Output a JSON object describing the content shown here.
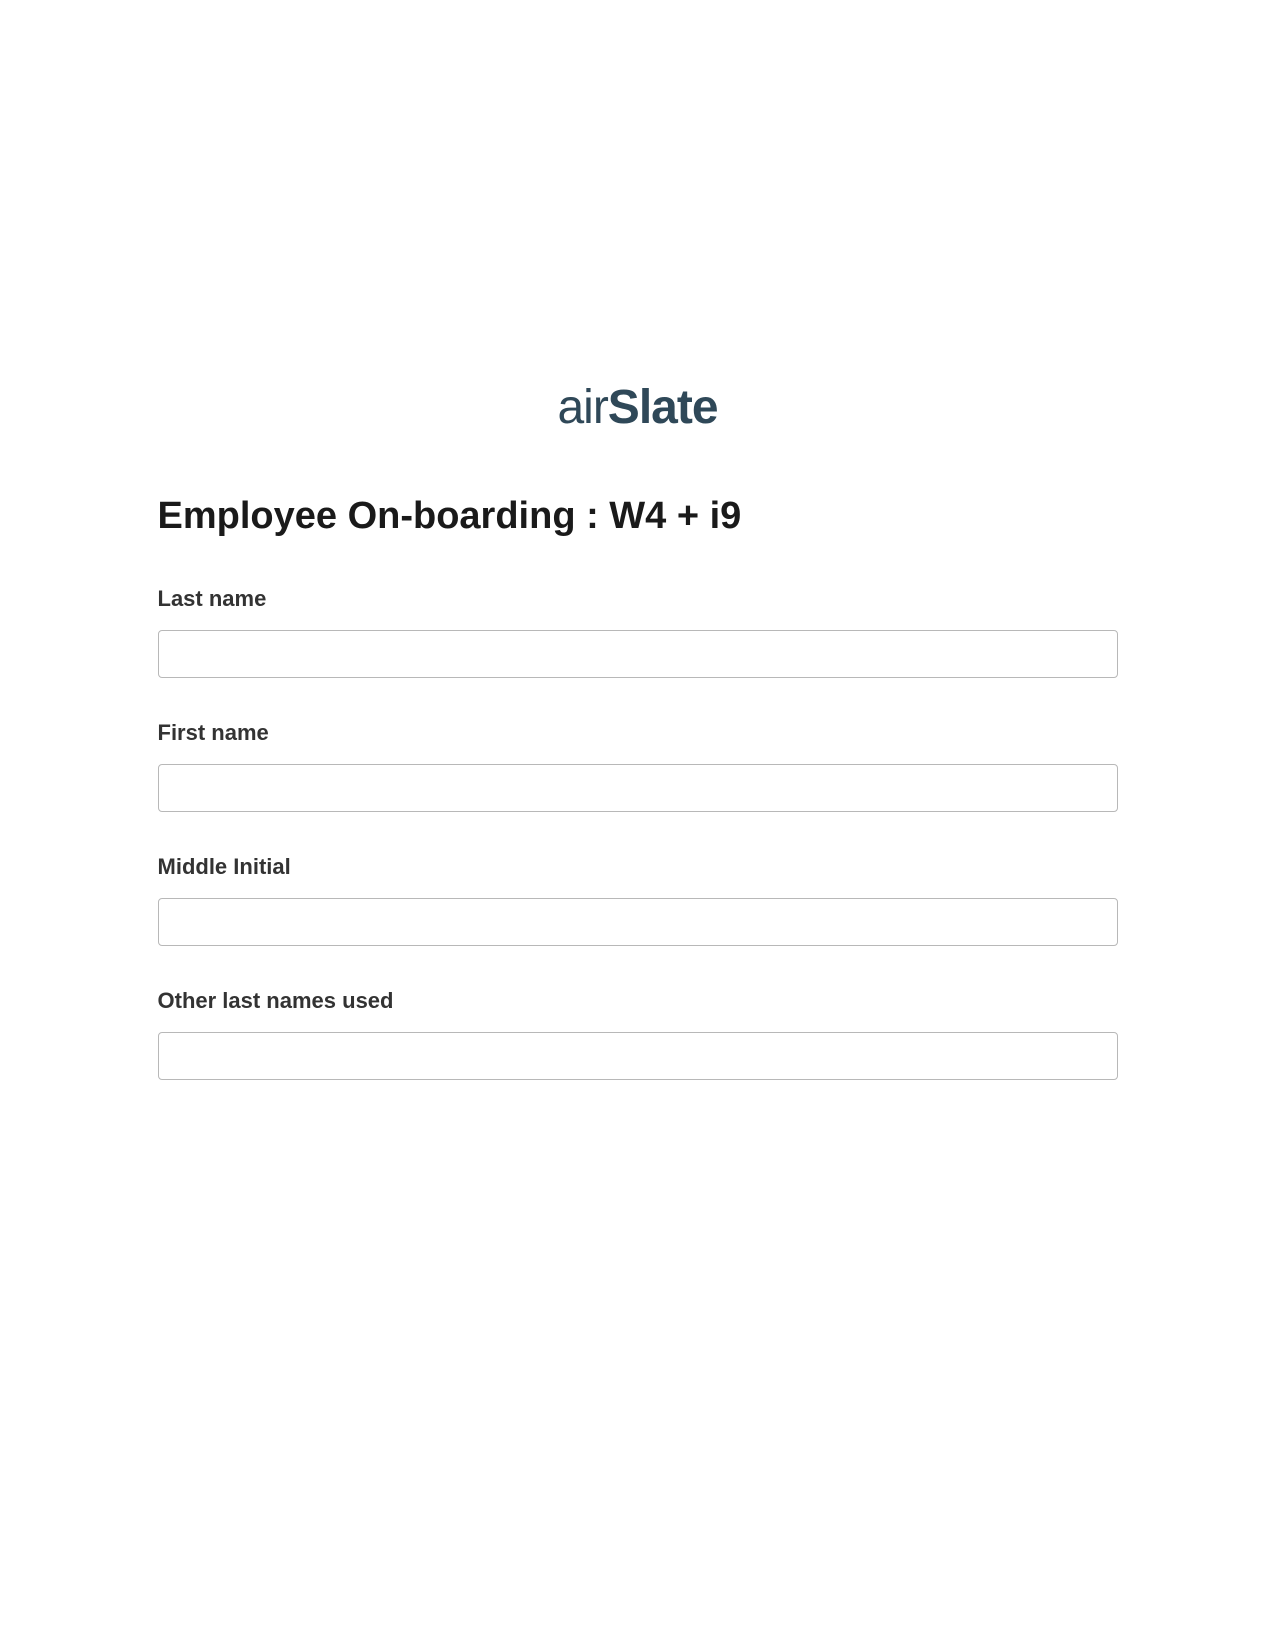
{
  "logo": {
    "part1": "air",
    "part2": "Slate"
  },
  "form": {
    "title": "Employee On-boarding : W4 + i9",
    "fields": [
      {
        "label": "Last name",
        "value": ""
      },
      {
        "label": "First name",
        "value": ""
      },
      {
        "label": "Middle Initial",
        "value": ""
      },
      {
        "label": "Other last names used",
        "value": ""
      }
    ]
  }
}
